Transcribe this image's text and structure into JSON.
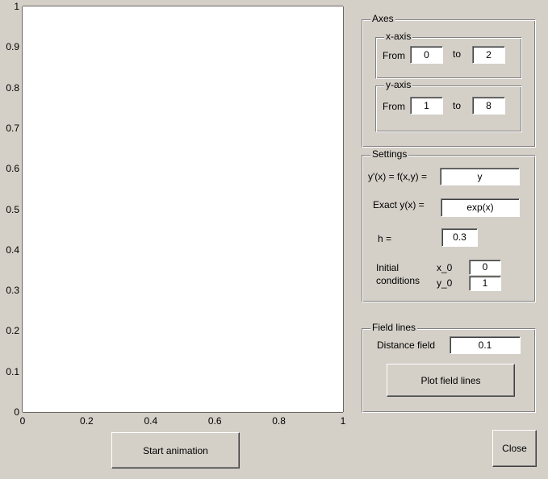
{
  "plot": {
    "y_ticks": [
      "0",
      "0.1",
      "0.2",
      "0.3",
      "0.4",
      "0.5",
      "0.6",
      "0.7",
      "0.8",
      "0.9",
      "1"
    ],
    "x_ticks": [
      "0",
      "0.2",
      "0.4",
      "0.6",
      "0.8",
      "1"
    ],
    "xlim": [
      0,
      1
    ],
    "ylim": [
      0,
      1
    ]
  },
  "axes_panel": {
    "title": "Axes",
    "xaxis": {
      "title": "x-axis",
      "from_label": "From",
      "from_value": "0",
      "to_label": "to",
      "to_value": "2"
    },
    "yaxis": {
      "title": "y-axis",
      "from_label": "From",
      "from_value": "1",
      "to_label": "to",
      "to_value": "8"
    }
  },
  "settings_panel": {
    "title": "Settings",
    "ode_label": "y'(x) = f(x,y) =",
    "ode_value": "y",
    "exact_label": "Exact y(x) =",
    "exact_value": "exp(x)",
    "h_label": "h =",
    "h_value": "0.3",
    "initial_label_line1": "Initial",
    "initial_label_line2": "conditions",
    "x0_label": "x_0",
    "x0_value": "0",
    "y0_label": "y_0",
    "y0_value": "1"
  },
  "field_panel": {
    "title": "Field lines",
    "distance_label": "Distance field",
    "distance_value": "0.1",
    "plot_button": "Plot field lines"
  },
  "buttons": {
    "start": "Start animation",
    "close": "Close"
  }
}
